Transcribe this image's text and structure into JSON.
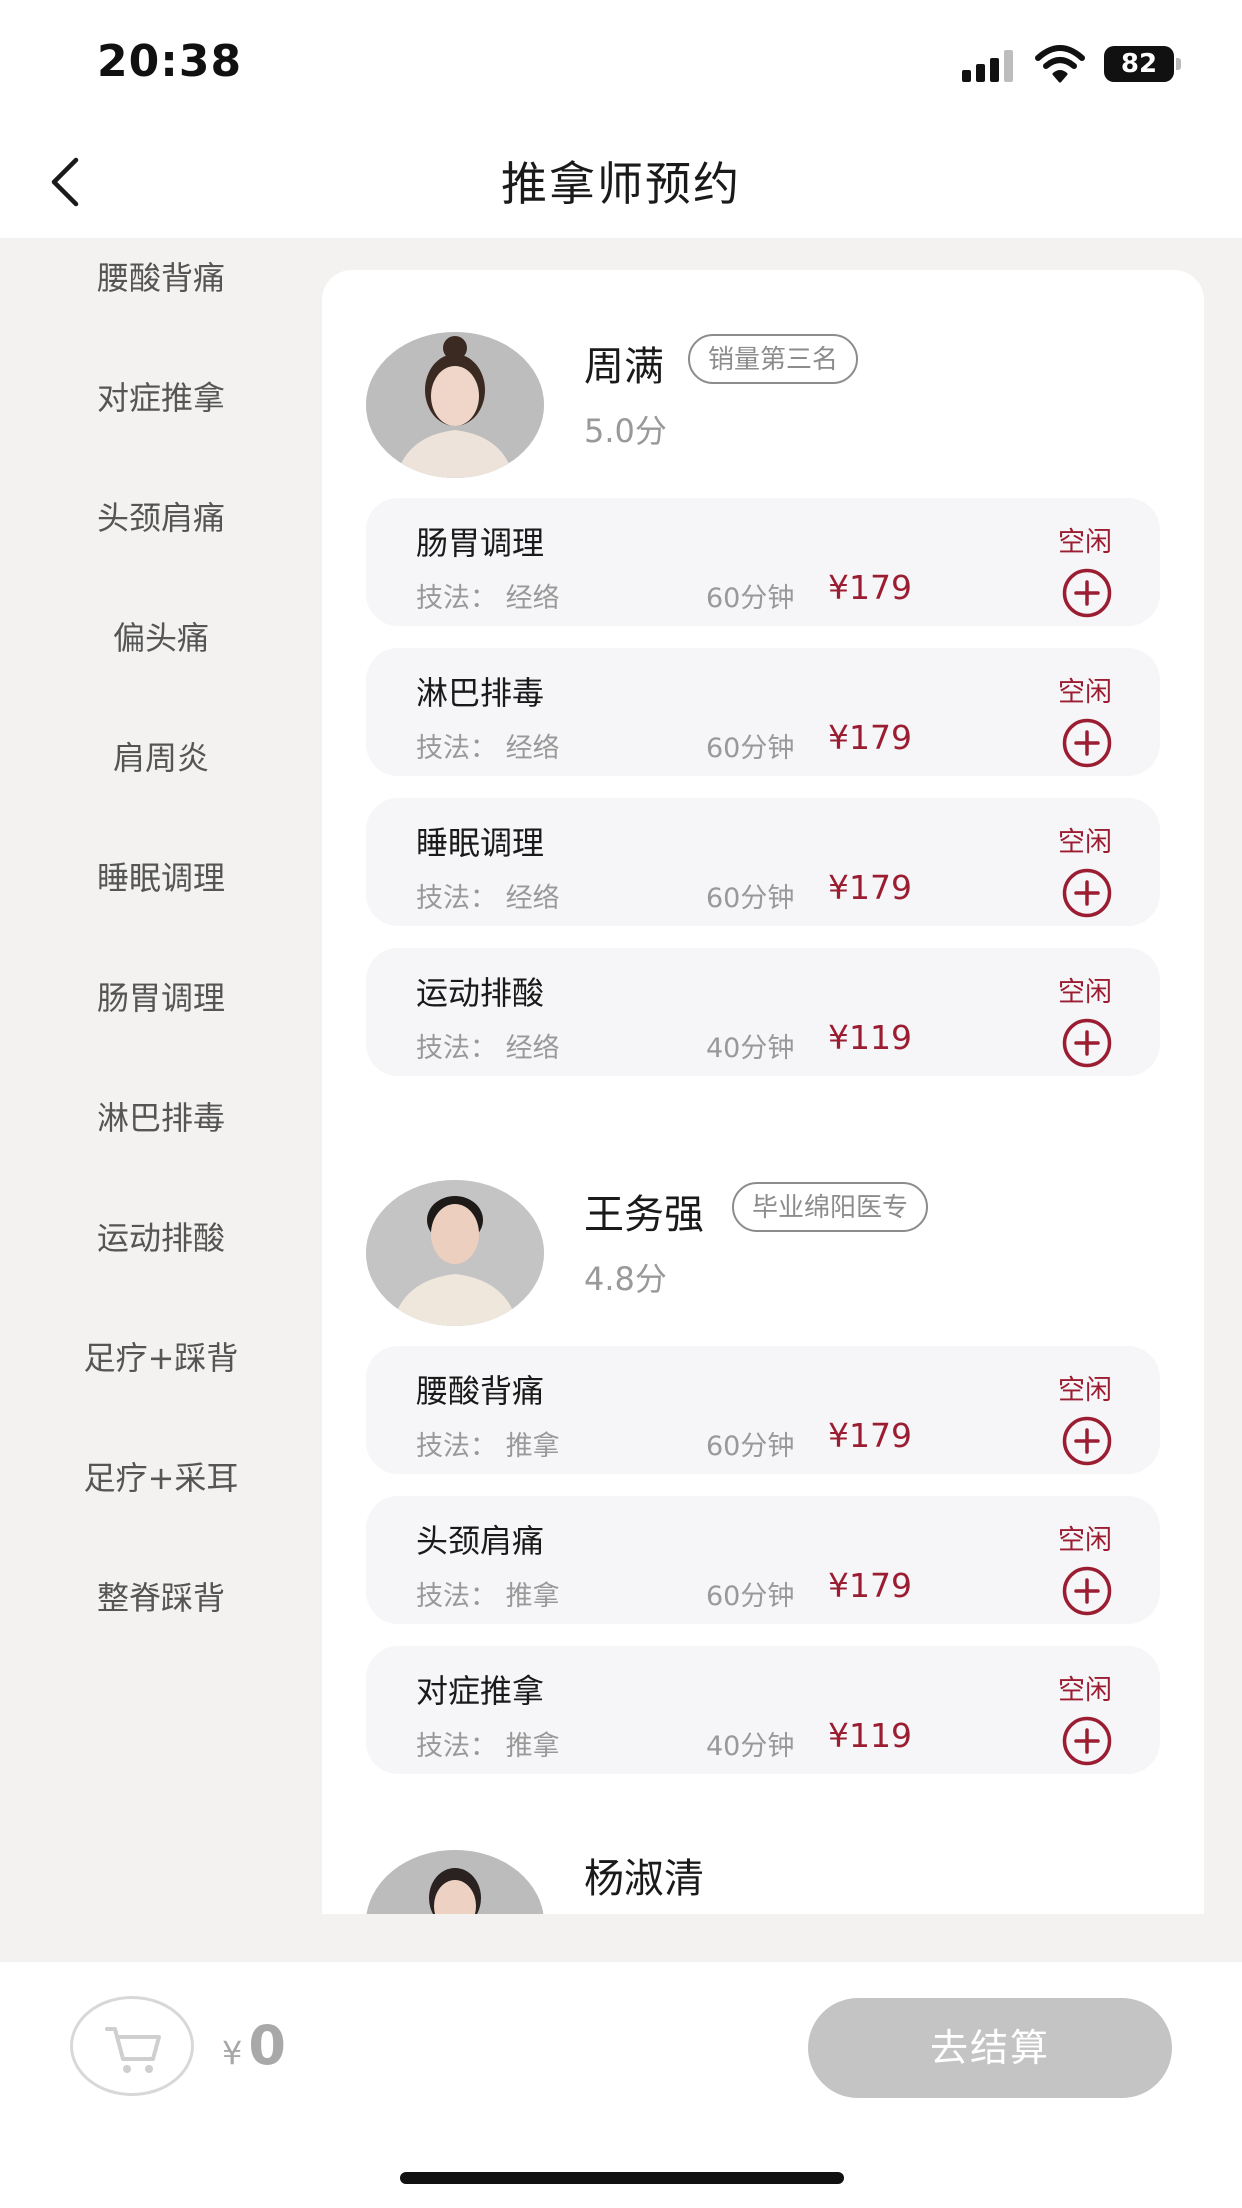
{
  "status_bar": {
    "time": "20:38",
    "battery": "82"
  },
  "nav": {
    "title": "推拿师预约"
  },
  "sidebar": {
    "items": [
      {
        "label": "腰酸背痛"
      },
      {
        "label": "对症推拿"
      },
      {
        "label": "头颈肩痛"
      },
      {
        "label": "偏头痛"
      },
      {
        "label": "肩周炎"
      },
      {
        "label": "睡眠调理"
      },
      {
        "label": "肠胃调理"
      },
      {
        "label": "淋巴排毒"
      },
      {
        "label": "运动排酸"
      },
      {
        "label": "足疗+踩背"
      },
      {
        "label": "足疗+采耳"
      },
      {
        "label": "整脊踩背"
      }
    ]
  },
  "therapists": [
    {
      "name": "周满",
      "badge": "销量第三名",
      "score": "5.0分",
      "services": [
        {
          "name": "肠胃调理",
          "status": "空闲",
          "technique": "技法：  经络",
          "duration": "60分钟",
          "price": "¥179"
        },
        {
          "name": "淋巴排毒",
          "status": "空闲",
          "technique": "技法：  经络",
          "duration": "60分钟",
          "price": "¥179"
        },
        {
          "name": "睡眠调理",
          "status": "空闲",
          "technique": "技法：  经络",
          "duration": "60分钟",
          "price": "¥179"
        },
        {
          "name": "运动排酸",
          "status": "空闲",
          "technique": "技法：  经络",
          "duration": "40分钟",
          "price": "¥119"
        }
      ]
    },
    {
      "name": "王务强",
      "badge": "毕业绵阳医专",
      "score": "4.8分",
      "services": [
        {
          "name": "腰酸背痛",
          "status": "空闲",
          "technique": "技法：  推拿",
          "duration": "60分钟",
          "price": "¥179"
        },
        {
          "name": "头颈肩痛",
          "status": "空闲",
          "technique": "技法：  推拿",
          "duration": "60分钟",
          "price": "¥179"
        },
        {
          "name": "对症推拿",
          "status": "空闲",
          "technique": "技法：  推拿",
          "duration": "40分钟",
          "price": "¥119"
        }
      ]
    },
    {
      "name": "杨淑清"
    }
  ],
  "footer": {
    "currency": "¥",
    "total": "0",
    "checkout_label": "去结算"
  },
  "colors": {
    "accent": "#9b1d32",
    "background": "#f3f2f0",
    "checkout_disabled": "#c4c4c4"
  },
  "icons": {
    "back": "chevron-left-icon",
    "add": "plus-circle-icon",
    "cart": "shopping-cart-icon"
  }
}
